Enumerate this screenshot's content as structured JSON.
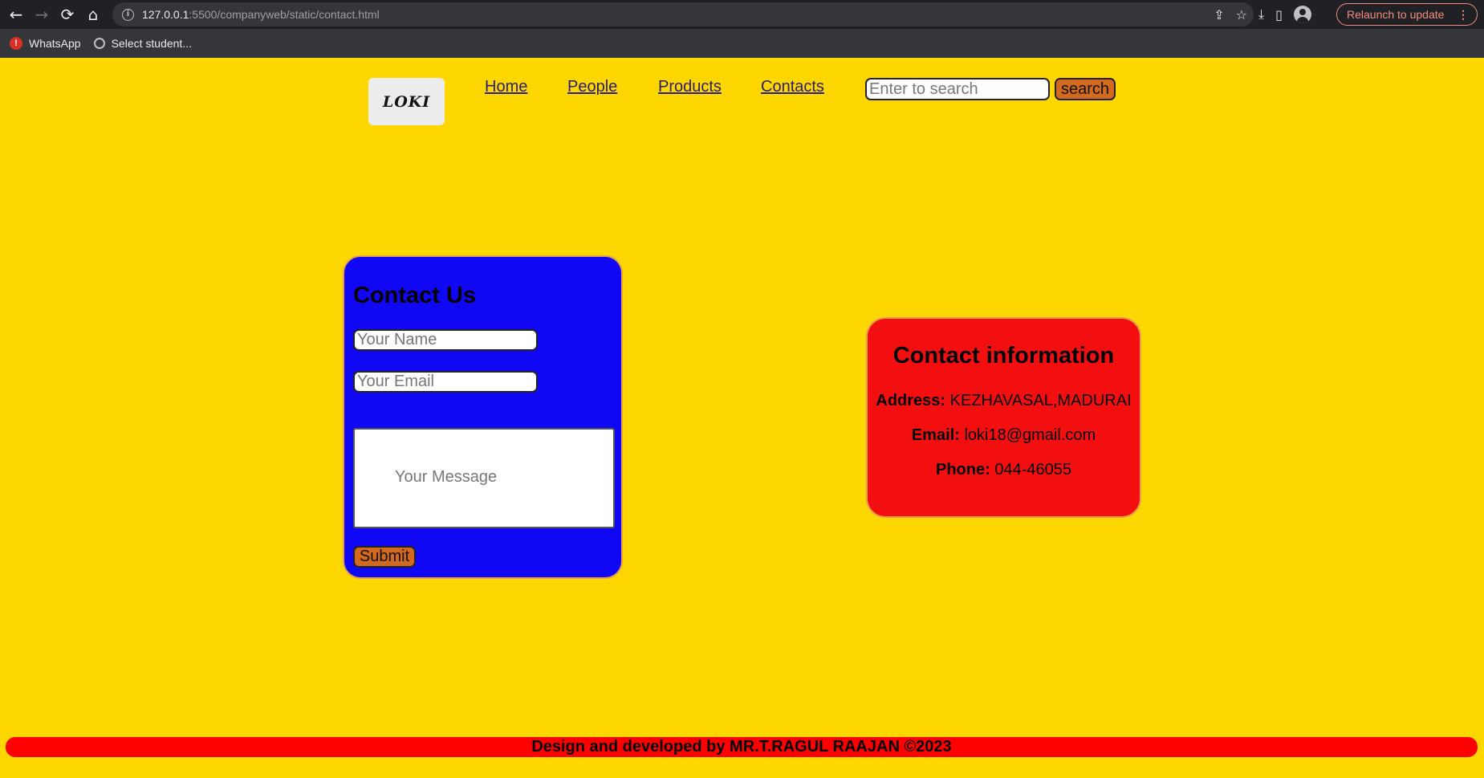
{
  "browser": {
    "url_host": "127.0.0.1",
    "url_rest": ":5500/companyweb/static/contact.html",
    "relaunch_label": "Relaunch to update",
    "bookmarks": [
      {
        "label": "WhatsApp"
      },
      {
        "label": "Select student..."
      }
    ]
  },
  "header": {
    "logo_text": "LOKI",
    "nav": [
      {
        "label": "Home"
      },
      {
        "label": "People"
      },
      {
        "label": "Products"
      },
      {
        "label": "Contacts"
      }
    ],
    "search_placeholder": "Enter to search",
    "search_button": "search"
  },
  "contact_form": {
    "title": "Contact Us",
    "name_placeholder": "Your Name",
    "email_placeholder": "Your Email",
    "message_placeholder": "Your Message",
    "submit_label": "Submit"
  },
  "contact_info": {
    "title": "Contact information",
    "address_label": "Address:",
    "address_value": "KEZHAVASAL,MADURAI",
    "email_label": "Email:",
    "email_value": "loki18@gmail.com",
    "phone_label": "Phone:",
    "phone_value": "044-46055"
  },
  "footer": {
    "text": "Design and developed by MR.T.RAGUL RAAJAN ©2023"
  },
  "colors": {
    "page_bg": "#ffd700",
    "form_card": "#1007f4",
    "info_card": "#f30f10",
    "button": "#d2691e",
    "footer": "#ff0000"
  }
}
